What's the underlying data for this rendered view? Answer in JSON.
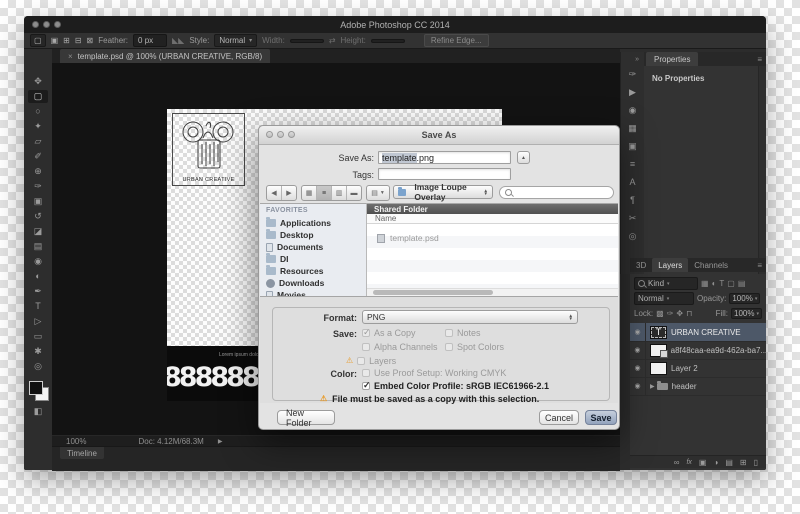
{
  "ps": {
    "window_title": "Adobe Photoshop CC 2014",
    "options": {
      "tool_icon": "▢",
      "mode_icons": [
        {
          "name": "new-selection-icon",
          "glyph": "▣"
        },
        {
          "name": "add-selection-icon",
          "glyph": "⊞"
        },
        {
          "name": "subtract-selection-icon",
          "glyph": "⊟"
        },
        {
          "name": "intersect-selection-icon",
          "glyph": "⊠"
        }
      ],
      "feather_label": "Feather:",
      "feather_value": "0 px",
      "antialias_icon": "◣◣",
      "style_label": "Style:",
      "style_value": "Normal",
      "width_label": "Width:",
      "swap_icon": "⇄",
      "height_label": "Height:",
      "refine_edge": "Refine Edge..."
    },
    "doc_tab": {
      "close": "×",
      "title": "template.psd @ 100% (URBAN CREATIVE, RGB/8)"
    },
    "tools": [
      {
        "name": "move-tool",
        "glyph": "✥"
      },
      {
        "name": "marquee-tool",
        "glyph": "▢"
      },
      {
        "name": "lasso-tool",
        "glyph": "○"
      },
      {
        "name": "magic-wand-tool",
        "glyph": "✦"
      },
      {
        "name": "crop-tool",
        "glyph": "▱"
      },
      {
        "name": "eyedropper-tool",
        "glyph": "✐"
      },
      {
        "name": "healing-brush-tool",
        "glyph": "⊕"
      },
      {
        "name": "brush-tool",
        "glyph": "✑"
      },
      {
        "name": "clone-stamp-tool",
        "glyph": "▣"
      },
      {
        "name": "history-brush-tool",
        "glyph": "↺"
      },
      {
        "name": "eraser-tool",
        "glyph": "◪"
      },
      {
        "name": "gradient-tool",
        "glyph": "▤"
      },
      {
        "name": "blur-tool",
        "glyph": "◉"
      },
      {
        "name": "dodge-tool",
        "glyph": "◐"
      },
      {
        "name": "pen-tool",
        "glyph": "✒"
      },
      {
        "name": "type-tool",
        "glyph": "T"
      },
      {
        "name": "path-select-tool",
        "glyph": "▷"
      },
      {
        "name": "shape-tool",
        "glyph": "▭"
      },
      {
        "name": "hand-tool",
        "glyph": "✱"
      },
      {
        "name": "zoom-tool",
        "glyph": "◎"
      },
      {
        "name": "quick-mask-button",
        "glyph": "◧"
      }
    ],
    "panel_strip": [
      {
        "name": "brush-presets-panel-icon",
        "glyph": "✑"
      },
      {
        "name": "actions-panel-icon",
        "glyph": "▶"
      },
      {
        "name": "history-panel-icon",
        "glyph": "◉"
      },
      {
        "name": "adjustments-panel-icon",
        "glyph": "▦"
      },
      {
        "name": "clone-source-panel-icon",
        "glyph": "▣"
      },
      {
        "name": "styles-panel-icon",
        "glyph": "≡"
      },
      {
        "name": "character-panel-icon",
        "glyph": "A"
      },
      {
        "name": "paragraph-panel-icon",
        "glyph": "¶"
      },
      {
        "name": "tool-presets-panel-icon",
        "glyph": "✂"
      },
      {
        "name": "navigator-panel-icon",
        "glyph": "◎"
      }
    ],
    "collapse_arrows": "»",
    "canvas": {
      "logo_caption": "URBAN CREATIVE",
      "lorem": "Lorem ipsum dolor sit amet,",
      "pattern": "88888888888888888888"
    },
    "status": {
      "zoom": "100%",
      "doc": "Doc: 4.12M/68.3M",
      "arrow": "▶",
      "timeline": "Timeline"
    },
    "properties": {
      "tab": "Properties",
      "empty": "No Properties",
      "menu_icon": "≡"
    },
    "layers": {
      "tabs": [
        "3D",
        "Layers",
        "Channels"
      ],
      "menu_icon": "≡",
      "filter_label": "Kind",
      "filter_icons": [
        {
          "name": "filter-pixel-icon",
          "glyph": "▦"
        },
        {
          "name": "filter-adjustment-icon",
          "glyph": "◐"
        },
        {
          "name": "filter-type-icon",
          "glyph": "T"
        },
        {
          "name": "filter-shape-icon",
          "glyph": "▢"
        },
        {
          "name": "filter-smart-object-icon",
          "glyph": "▤"
        }
      ],
      "blend": "Normal",
      "opacity_label": "Opacity:",
      "opacity": "100%",
      "lock_label": "Lock:",
      "lock_icons": [
        {
          "name": "lock-transparency-icon",
          "glyph": "▩"
        },
        {
          "name": "lock-pixels-icon",
          "glyph": "✑"
        },
        {
          "name": "lock-position-icon",
          "glyph": "✥"
        },
        {
          "name": "lock-all-icon",
          "glyph": "⊓"
        }
      ],
      "fill_label": "Fill:",
      "fill": "100%",
      "eye_icon": "◉",
      "rows": [
        {
          "name": "URBAN CREATIVE",
          "thumb": "T"
        },
        {
          "name": "a8f48caa-ea9d-462a-ba7..."
        },
        {
          "name": "Layer 2"
        },
        {
          "name": "header",
          "arrow": "▶"
        }
      ],
      "bottom_icons": [
        {
          "name": "link-layers-icon",
          "glyph": "∞"
        },
        {
          "name": "layer-effects-icon",
          "glyph": "fx"
        },
        {
          "name": "layer-mask-icon",
          "glyph": "▣"
        },
        {
          "name": "adjustment-layer-icon",
          "glyph": "◑"
        },
        {
          "name": "new-group-icon",
          "glyph": "▤"
        },
        {
          "name": "new-layer-icon",
          "glyph": "⊞"
        },
        {
          "name": "delete-layer-icon",
          "glyph": "▯"
        }
      ]
    }
  },
  "dialog": {
    "title": "Save As",
    "save_as_label": "Save As:",
    "filename_selected": "template",
    "filename_ext": ".png",
    "expand_icon": "▲",
    "tags_label": "Tags:",
    "back_icon": "◀",
    "forward_icon": "▶",
    "view_icons": [
      {
        "name": "icon-view-icon",
        "glyph": "▦"
      },
      {
        "name": "list-view-icon",
        "glyph": "≡"
      },
      {
        "name": "column-view-icon",
        "glyph": "▥"
      },
      {
        "name": "coverflow-view-icon",
        "glyph": "▬"
      }
    ],
    "action_icon": "▤",
    "location": "Image Loupe Overlay",
    "favorites_header": "FAVORITES",
    "sidebar_items": [
      {
        "label": "Applications"
      },
      {
        "label": "Desktop"
      },
      {
        "label": "Documents"
      },
      {
        "label": "DI"
      },
      {
        "label": "Resources"
      },
      {
        "label": "Downloads"
      },
      {
        "label": "Movies"
      }
    ],
    "list_header": "Shared Folder",
    "column_name": "Name",
    "file_name": "template.psd",
    "format_label": "Format:",
    "format_value": "PNG",
    "save_label": "Save:",
    "save_options": [
      {
        "label": "As a Copy",
        "checked": true
      },
      {
        "label": "Notes",
        "checked": false
      },
      {
        "label": "Alpha Channels",
        "checked": false
      },
      {
        "label": "Spot Colors",
        "checked": false
      },
      {
        "label": "Layers",
        "checked": false
      }
    ],
    "color_label": "Color:",
    "color_options": [
      {
        "label": "Use Proof Setup: Working CMYK",
        "checked": false
      },
      {
        "label": "Embed Color Profile: sRGB IEC61966-2.1",
        "checked": true
      }
    ],
    "warning_icon": "⚠",
    "warning_text": "File must be saved as a copy with this selection.",
    "new_folder_label": "New Folder",
    "cancel_label": "Cancel",
    "save_button_label": "Save"
  },
  "colors": {
    "selected_layer": "#4d5868",
    "warning": "#e89c2c",
    "ps_panel_bg": "#333333",
    "dialog_bg": "#e3e3e3"
  }
}
